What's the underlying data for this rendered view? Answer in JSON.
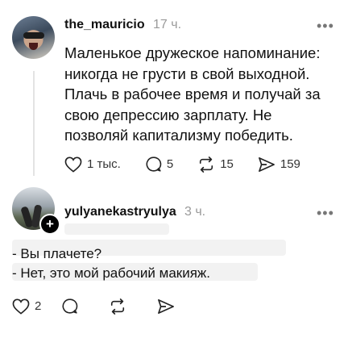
{
  "post": {
    "username": "the_mauricio",
    "time": "17 ч.",
    "more": "•••",
    "text_lines": [
      "Маленькое дружеское напоминание:",
      "никогда не грусти в свой выходной.",
      "Плачь в рабочее время и получай за",
      "свою депрессию зарплату. Не",
      "позволяй капитализму победить."
    ],
    "likes": "1 тыс.",
    "comments": "5",
    "reposts": "15",
    "shares": "159"
  },
  "reply": {
    "username": "yulyanekastryulya",
    "time": "3 ч.",
    "more": "•••",
    "text_lines": [
      "- Вы плачете?",
      "- Нет, это мой рабочий макияж."
    ],
    "likes": "2",
    "comments": "",
    "reposts": "",
    "shares": ""
  },
  "icons": {
    "like": "heart-icon",
    "comment": "comment-icon",
    "repost": "repost-icon",
    "share": "send-icon",
    "follow": "plus-icon"
  }
}
